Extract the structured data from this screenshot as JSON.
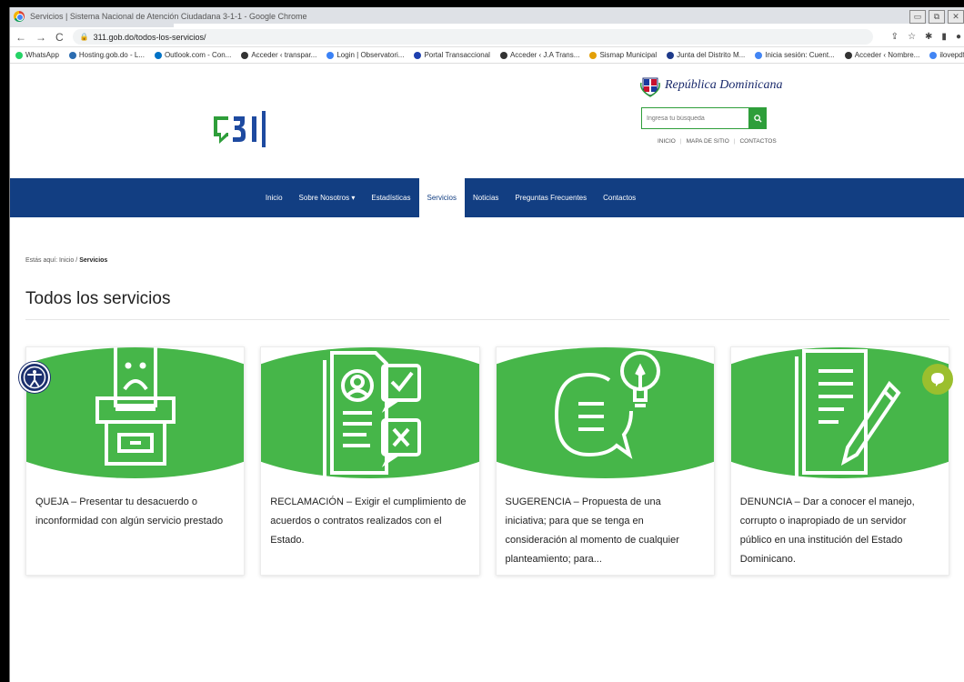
{
  "browser": {
    "window_title": "Servicios | Sistema Nacional de Atención Ciudadana 3-1-1 - Google Chrome",
    "url": "311.gob.do/todos-los-servicios/",
    "window_controls": [
      "▭",
      "⧉",
      "✕"
    ],
    "bookmarks": [
      {
        "label": "WhatsApp",
        "color": "#25d366"
      },
      {
        "label": "Hosting.gob.do - L...",
        "color": "#2b6cb0"
      },
      {
        "label": "Outlook.com - Con...",
        "color": "#0072c6"
      },
      {
        "label": "Acceder ‹ transpar...",
        "color": "#333333"
      },
      {
        "label": "Login | Observatori...",
        "color": "#3b82f6"
      },
      {
        "label": "Portal Transaccional",
        "color": "#1e40af"
      },
      {
        "label": "Acceder ‹ J.A Trans...",
        "color": "#333333"
      },
      {
        "label": "Sismap Municipal",
        "color": "#e3a008"
      },
      {
        "label": "Junta del Distrito M...",
        "color": "#1e3a8a"
      },
      {
        "label": "Inicia sesión: Cuent...",
        "color": "#4285f4"
      },
      {
        "label": "Acceder ‹ Nombre...",
        "color": "#333333"
      },
      {
        "label": "ilovepdf - Buscar co...",
        "color": "#4285f4"
      }
    ]
  },
  "header": {
    "brand_name": "República Dominicana",
    "search_placeholder": "Ingresa tu búsqueda",
    "top_links": [
      "INICIO",
      "MAPA DE SITIO",
      "CONTACTOS"
    ]
  },
  "nav": {
    "items": [
      {
        "label": "Inicio",
        "active": false
      },
      {
        "label": "Sobre Nosotros ▾",
        "active": false
      },
      {
        "label": "Estadísticas",
        "active": false
      },
      {
        "label": "Servicios",
        "active": true
      },
      {
        "label": "Noticias",
        "active": false
      },
      {
        "label": "Preguntas Frecuentes",
        "active": false
      },
      {
        "label": "Contactos",
        "active": false
      }
    ]
  },
  "breadcrumb": {
    "prefix": "Estás aquí:",
    "home": "Inicio",
    "separator": "/",
    "current": "Servicios"
  },
  "page_title": "Todos los servicios",
  "cards": [
    {
      "icon": "complaint-box-icon",
      "text": "QUEJA – Presentar tu desacuerdo o inconformidad con algún servicio prestado"
    },
    {
      "icon": "claim-document-icon",
      "text": "RECLAMACIÓN – Exigir el cumplimiento de acuerdos o contratos realizados con el Estado."
    },
    {
      "icon": "idea-bubble-icon",
      "text": "SUGERENCIA – Propuesta de una iniciativa; para que se tenga en consideración al momento de cualquier planteamiento; para..."
    },
    {
      "icon": "document-pen-icon",
      "text": "DENUNCIA – Dar a conocer el manejo, corrupto o inapropiado de un servidor público en una institución del Estado Dominicano."
    }
  ],
  "colors": {
    "nav_bg": "#123e82",
    "brand_green": "#46b649",
    "chat_green": "#9bbf2e",
    "a11y_blue": "#1b2f6e"
  }
}
